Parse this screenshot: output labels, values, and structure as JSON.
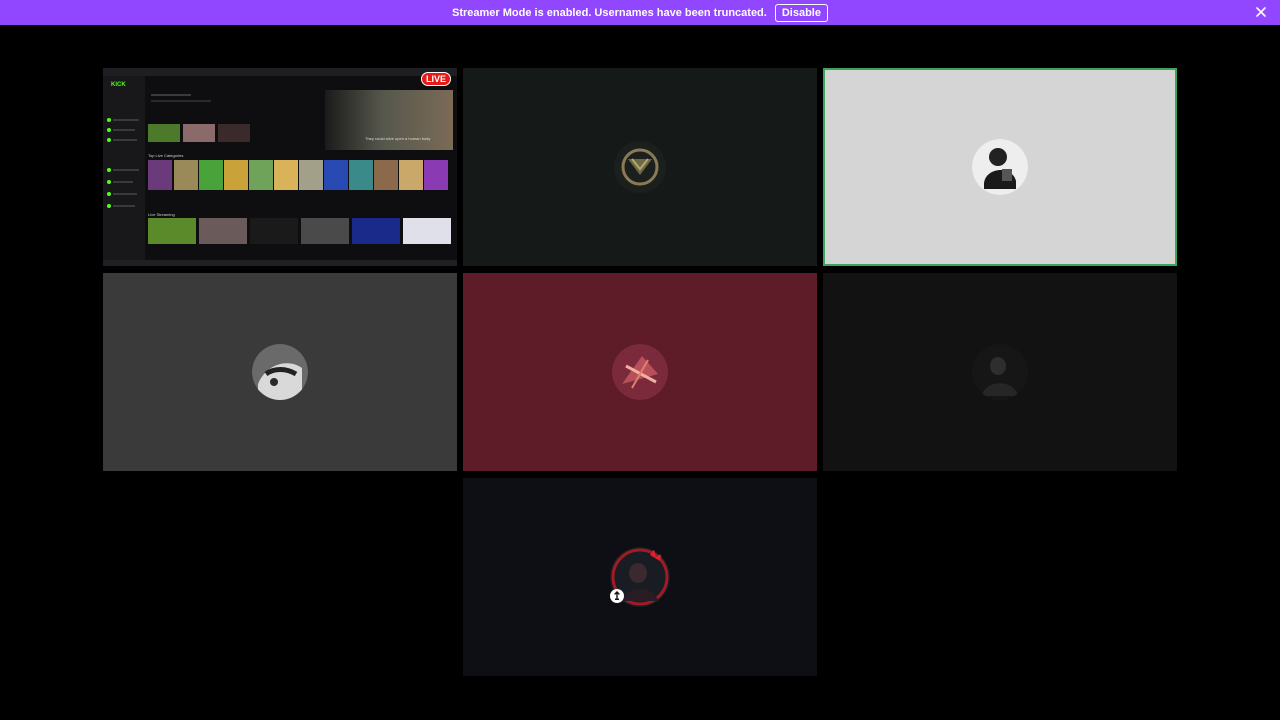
{
  "banner": {
    "message": "Streamer Mode is enabled. Usernames have been truncated.",
    "disable_label": "Disable",
    "background": "#9146ff"
  },
  "tiles": [
    {
      "kind": "screen-share",
      "live_label": "LIVE",
      "background": "#0e0e10"
    },
    {
      "kind": "participant",
      "background": "#151a19",
      "speaking": false
    },
    {
      "kind": "participant",
      "background": "#d5d5d5",
      "speaking": true,
      "speaking_border": "#3ba55c"
    },
    {
      "kind": "participant",
      "background": "#3a3a3a",
      "speaking": false
    },
    {
      "kind": "participant",
      "background": "#5e1b28",
      "speaking": false
    },
    {
      "kind": "participant",
      "background": "#121212",
      "speaking": false
    },
    {
      "kind": "participant",
      "background": "#0d0f14",
      "speaking": false,
      "status_icon": "crown-icon"
    }
  ],
  "screen_share": {
    "site_logo": "KICK",
    "hero_caption": "They could alive open a human body",
    "sections": [
      "Top Live Categories",
      "Live Streaming"
    ]
  }
}
